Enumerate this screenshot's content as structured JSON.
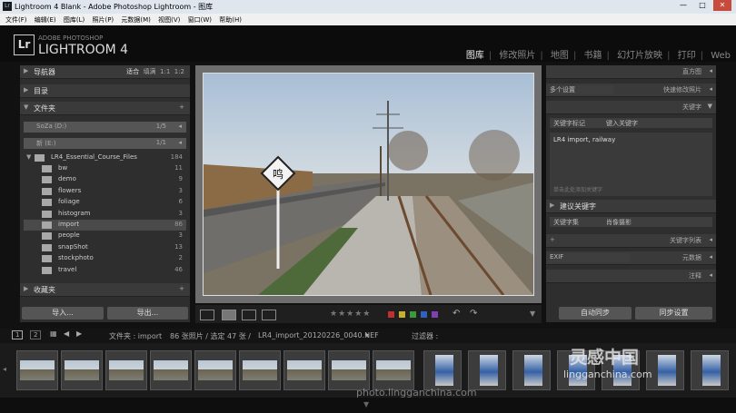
{
  "window": {
    "title": "Lightroom 4 Blank - Adobe Photoshop Lightroom - 图库",
    "icon_text": "Lr",
    "buttons": [
      "—",
      "□",
      "✕"
    ]
  },
  "menu": [
    "文件(F)",
    "编辑(E)",
    "图库(L)",
    "照片(P)",
    "元数据(M)",
    "视图(V)",
    "窗口(W)",
    "帮助(H)"
  ],
  "identity": {
    "logo": "Lr",
    "brand_top": "ADOBE PHOTOSHOP",
    "brand_main": "LIGHTROOM 4"
  },
  "modules": [
    "图库",
    "修改照片",
    "地图",
    "书籍",
    "幻灯片放映",
    "打印",
    "Web"
  ],
  "left_panel": {
    "navigator": {
      "label": "导航器",
      "opts": [
        "适合",
        "填满",
        "1:1",
        "1:2"
      ]
    },
    "catalog": {
      "label": "目录"
    },
    "folders": {
      "label": "文件夹",
      "add": "+"
    },
    "volumes": [
      {
        "name": "SoZa (D:)",
        "count": "1/5",
        "arrow": "◂"
      },
      {
        "name": "新 (E:)",
        "count": "1/1",
        "arrow": "◂"
      }
    ],
    "root_folder": {
      "name": "LR4_Essential_Course_Files",
      "count": "184"
    },
    "subfolders": [
      {
        "name": "bw",
        "count": "11"
      },
      {
        "name": "demo",
        "count": "9"
      },
      {
        "name": "flowers",
        "count": "3"
      },
      {
        "name": "foliage",
        "count": "6"
      },
      {
        "name": "histogram",
        "count": "3"
      },
      {
        "name": "import",
        "count": "86"
      },
      {
        "name": "people",
        "count": "3"
      },
      {
        "name": "snapShot",
        "count": "13"
      },
      {
        "name": "stockphoto",
        "count": "2"
      },
      {
        "name": "travel",
        "count": "46"
      }
    ],
    "collections": {
      "label": "收藏夹",
      "add": "+"
    },
    "import_btn": "导入...",
    "export_btn": "导出..."
  },
  "right_panel": {
    "histogram": {
      "label": "直方图"
    },
    "quick_develop": {
      "preset": "多个设置",
      "label": "快速修改照片"
    },
    "keywording": {
      "label": "关键字",
      "tag_label": "关键字标记",
      "tag_value": "键入关键字",
      "keywords": "LR4 import, railway",
      "hint": "单击此处添加关键字"
    },
    "suggestions": {
      "label": "建议关键字"
    },
    "keyword_set": {
      "label": "关键字集",
      "value": "肖像摄影"
    },
    "keyword_list": {
      "label": "关键字列表",
      "add": "+"
    },
    "metadata": {
      "preset": "EXIF",
      "label": "元数据"
    },
    "comments": {
      "label": "注释"
    },
    "sync_meta": "自动同步",
    "sync_settings": "同步设置"
  },
  "toolbar": {
    "stars": "★★★★★"
  },
  "filmstrip_bar": {
    "pages": [
      "1",
      "2"
    ],
    "path": "文件夹 : import",
    "info": "86 张照片 / 选定 47 张 /",
    "file": "LR4_import_20120226_0040.NEF",
    "filter_label": "过滤器 :"
  },
  "watermark": {
    "line1": "灵感中国",
    "line2": "lingganchina.com",
    "line3": "photo.lingganchina.com"
  },
  "colors": {
    "label_red": "#c03030",
    "label_yellow": "#c9b02a",
    "label_green": "#3a9a3a",
    "label_blue": "#3060c0",
    "label_purple": "#8040b0"
  }
}
